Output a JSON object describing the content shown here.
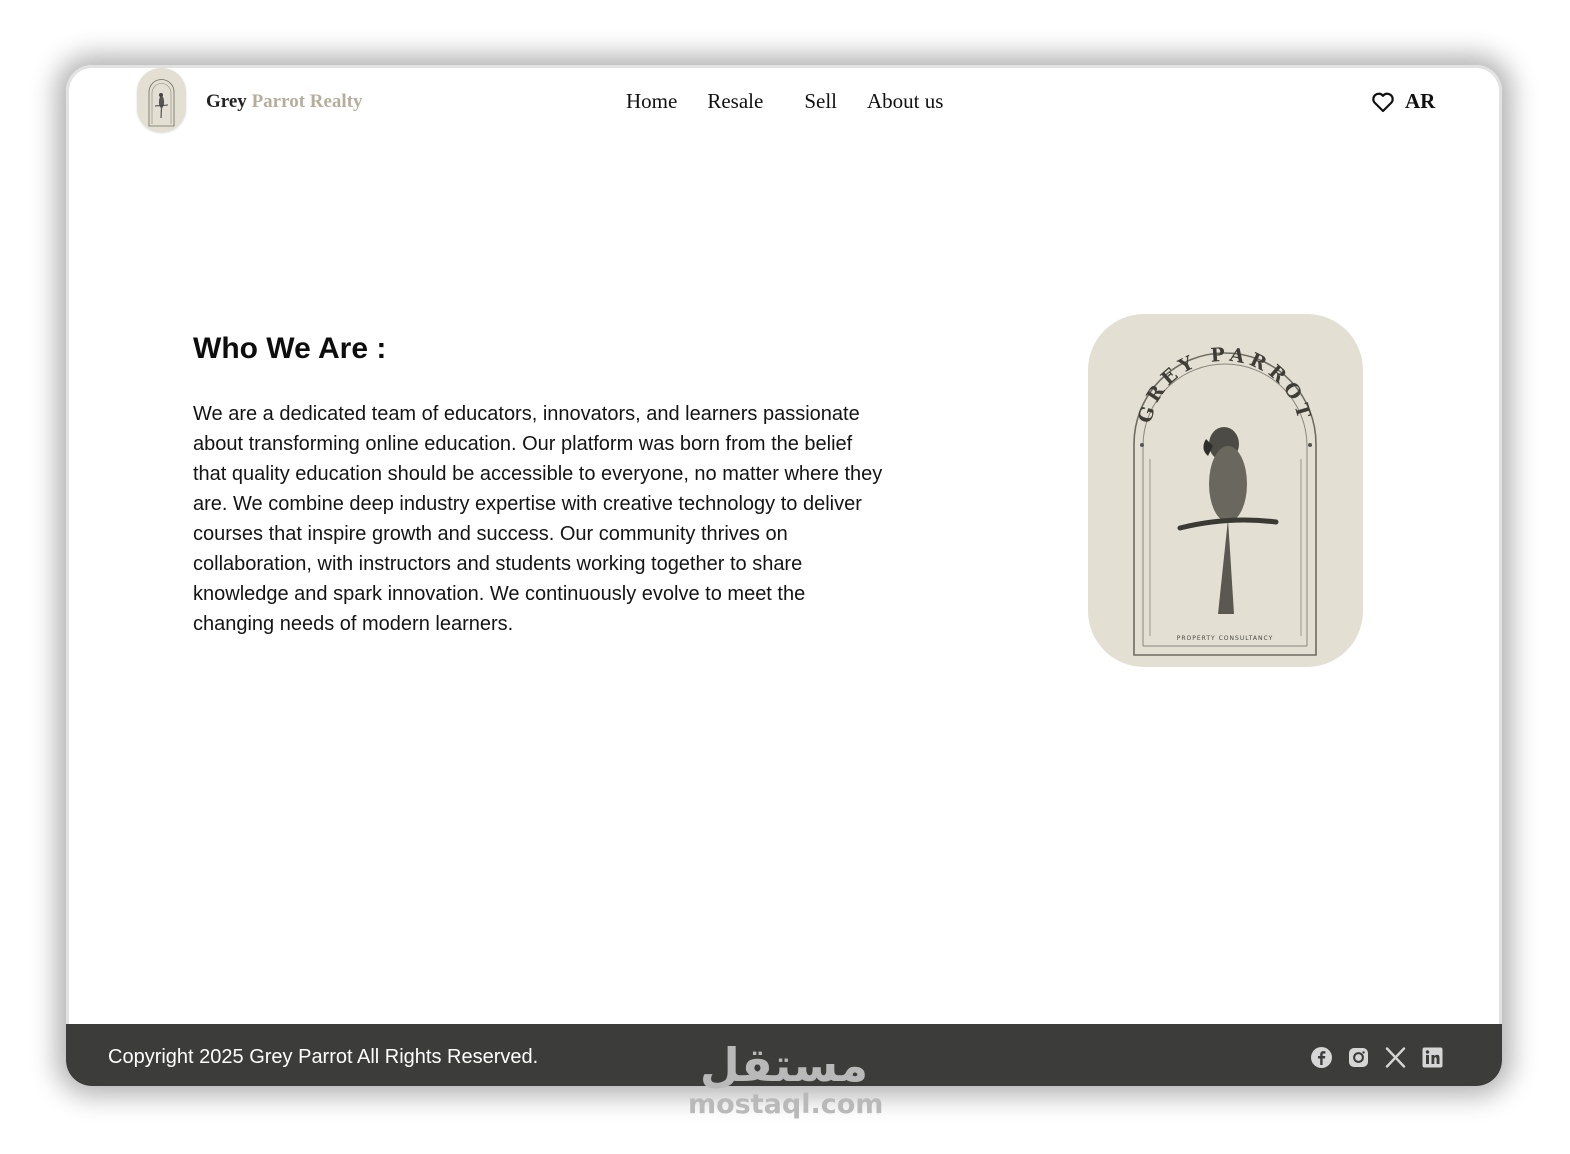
{
  "brand": {
    "word1": "Grey",
    "word2": "Parrot Realty"
  },
  "nav": {
    "items": [
      "Home",
      "Resale",
      "Sell",
      "About us"
    ]
  },
  "header": {
    "lang_label": "AR"
  },
  "about": {
    "heading": "Who We Are :",
    "body": "We are a dedicated team of educators, innovators, and learners passionate about transforming online education. Our platform was born from the belief that quality education should be accessible to everyone, no matter where they are. We combine deep industry expertise with creative technology to deliver courses that inspire growth and success. Our community thrives on collaboration, with instructors and students working together to share knowledge and spark innovation. We continuously evolve to meet the changing needs of modern learners."
  },
  "logo": {
    "arc_text": "GREY PARROT",
    "tagline": "PROPERTY CONSULTANCY"
  },
  "footer": {
    "copyright": "Copyright 2025 Grey Parrot All Rights Reserved.",
    "socials": [
      "facebook-icon",
      "instagram-icon",
      "x-icon",
      "linkedin-icon"
    ]
  },
  "watermark": {
    "glyph": "مستقل",
    "site": "mostaql.com"
  },
  "colors": {
    "accent": "#b6ae9c",
    "badge": "#e3dfd2",
    "footer": "#3c3c3b"
  }
}
